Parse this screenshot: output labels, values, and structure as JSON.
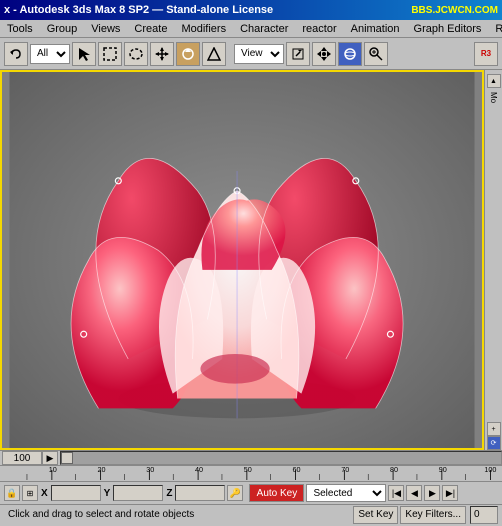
{
  "titleBar": {
    "text": "x - Autodesk 3ds Max 8 SP2 — Stand-alone License",
    "bbs": "BBS.JCWCN.COM"
  },
  "menuBar": {
    "items": [
      "Tools",
      "Group",
      "Views",
      "Create",
      "Modifiers",
      "Character",
      "reactor",
      "Animation",
      "Graph Editors",
      "Renderi..."
    ]
  },
  "toolbar": {
    "allLabel": "All",
    "viewLabel": "View"
  },
  "viewport": {
    "frameNumber": "100"
  },
  "ruler": {
    "marks": [
      "10",
      "20",
      "30",
      "40",
      "50",
      "60",
      "70",
      "80",
      "90",
      "100"
    ]
  },
  "statusBar": {
    "coords": {
      "x": "",
      "y": "",
      "z": ""
    },
    "autoKeyLabel": "Auto Key",
    "selectedLabel": "Selected",
    "setKeyLabel": "Set Key",
    "keyFiltersLabel": "Key Filters...",
    "message": "Click and drag to select and rotate objects"
  },
  "rightPanel": {
    "moLabel": "Mo"
  }
}
